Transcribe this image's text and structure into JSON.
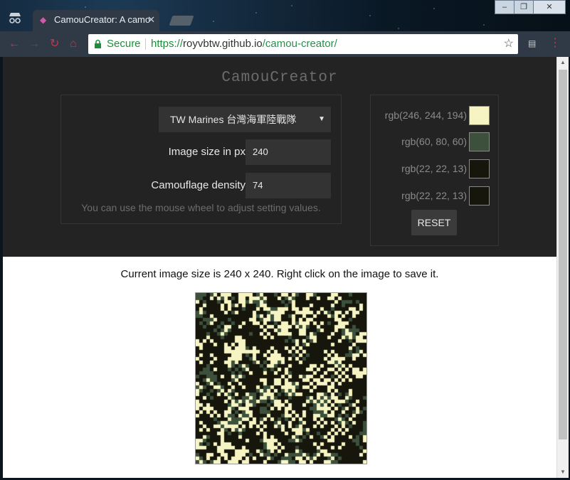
{
  "browser": {
    "tab_title": "CamouCreator: A camo",
    "url_secure": "Secure",
    "url_scheme": "https://",
    "url_host": "royvbtw.github.io",
    "url_path": "/camou-creator/"
  },
  "app": {
    "title": "CamouCreator",
    "pattern_select": "TW Marines 台灣海軍陸戰隊",
    "image_size_label": "Image size in px",
    "image_size_value": "240",
    "density_label": "Camouflage density",
    "density_value": "74",
    "hint": "You can use the mouse wheel to adjust setting values.",
    "colors": [
      {
        "label": "rgb(246, 244, 194)",
        "hex": "#f6f4c2"
      },
      {
        "label": "rgb(60, 80, 60)",
        "hex": "#3c503c"
      },
      {
        "label": "rgb(22, 22, 13)",
        "hex": "#16160d"
      },
      {
        "label": "rgb(22, 22, 13)",
        "hex": "#16160d"
      }
    ],
    "reset_label": "RESET",
    "caption": "Current image size is 240 x 240. Right click on the image to save it.",
    "density": 74
  }
}
